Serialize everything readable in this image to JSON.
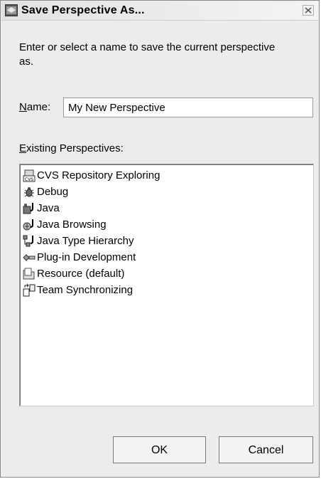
{
  "window": {
    "title": "Save Perspective As..."
  },
  "dialog": {
    "description": "Enter or select a name to save the current perspective as.",
    "name_label": "Name:",
    "name_value": "My New Perspective",
    "existing_label": "Existing Perspectives:"
  },
  "perspectives": [
    {
      "label": "CVS Repository Exploring",
      "icon": "cvs-repository-icon"
    },
    {
      "label": "Debug",
      "icon": "debug-bug-icon"
    },
    {
      "label": "Java",
      "icon": "java-perspective-icon"
    },
    {
      "label": "Java Browsing",
      "icon": "java-browsing-icon"
    },
    {
      "label": "Java Type Hierarchy",
      "icon": "type-hierarchy-icon"
    },
    {
      "label": "Plug-in Development",
      "icon": "plugin-icon"
    },
    {
      "label": "Resource (default)",
      "icon": "resource-folder-icon"
    },
    {
      "label": "Team Synchronizing",
      "icon": "team-sync-icon"
    }
  ],
  "buttons": {
    "ok": "OK",
    "cancel": "Cancel"
  }
}
